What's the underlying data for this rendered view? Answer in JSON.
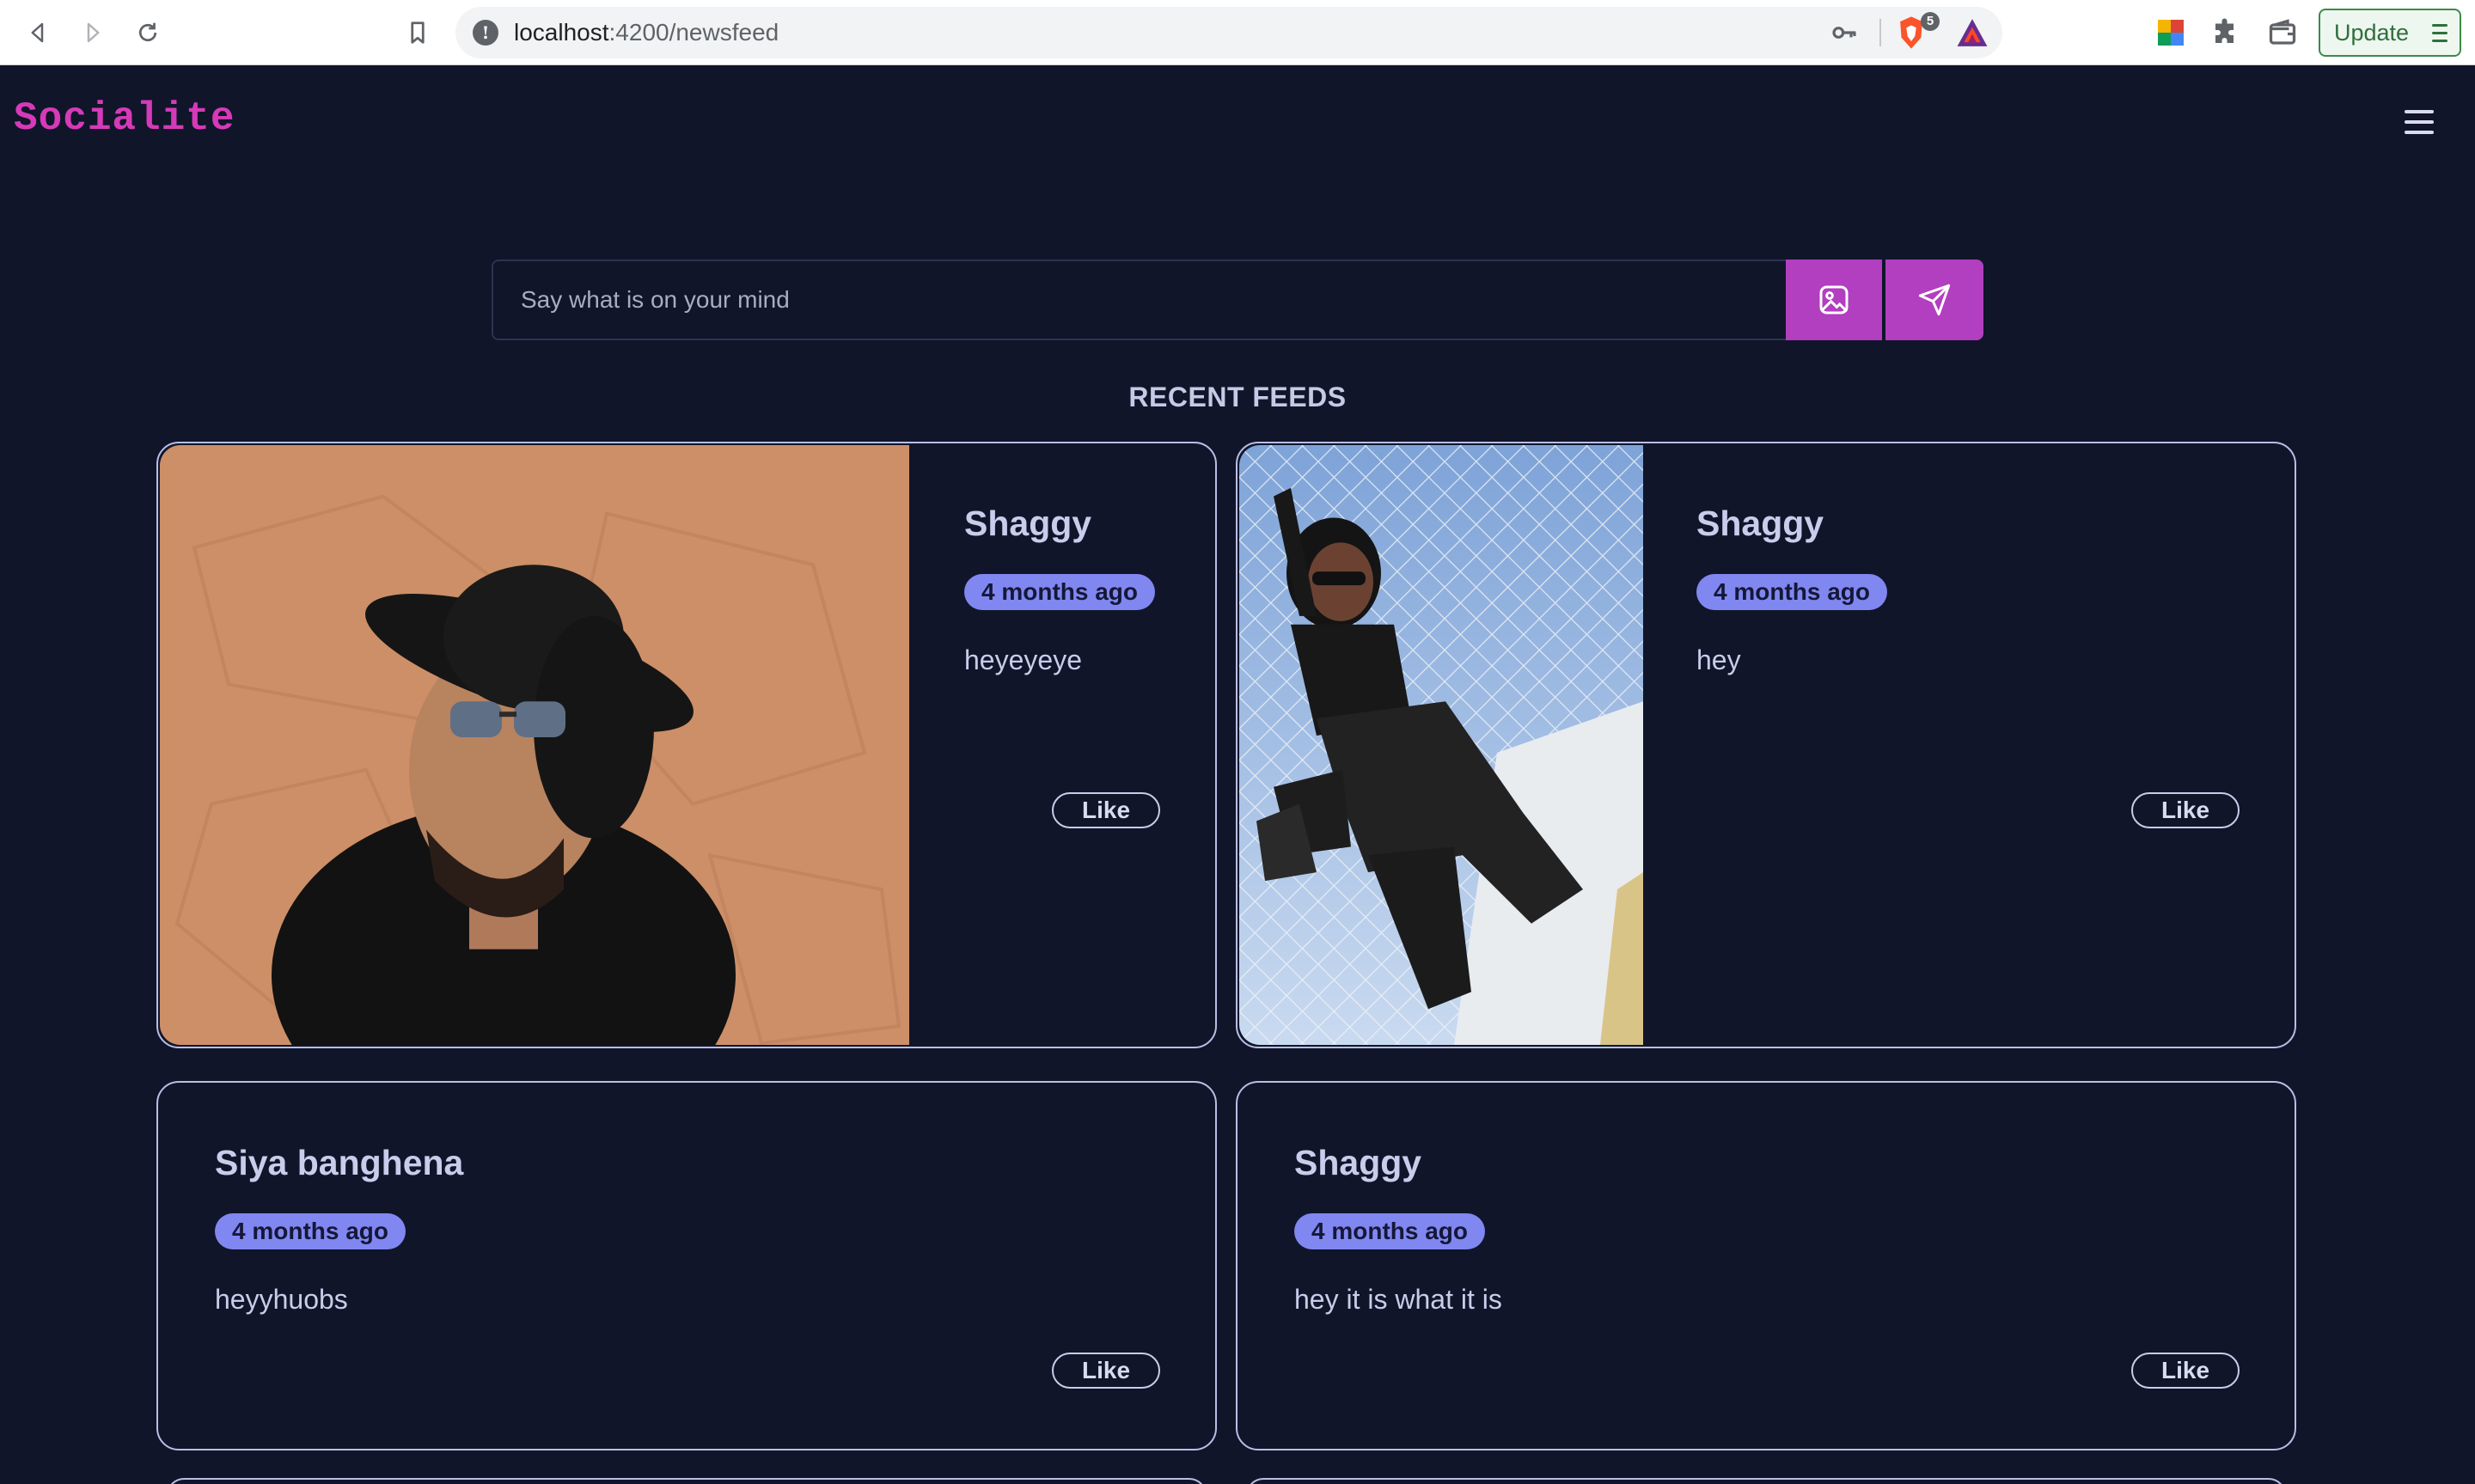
{
  "browser": {
    "url_host": "localhost",
    "url_path": ":4200/newsfeed",
    "brave_badge": "5",
    "update_label": "Update"
  },
  "app": {
    "logo": "Socialite"
  },
  "composer": {
    "placeholder": "Say what is on your mind"
  },
  "feed": {
    "title": "RECENT FEEDS",
    "posts": [
      {
        "author": "Shaggy",
        "time": "4 months ago",
        "text": "heyeyeye",
        "like_label": "Like",
        "photo": "man-in-hat-sunglasses"
      },
      {
        "author": "Shaggy",
        "time": "4 months ago",
        "text": "hey",
        "like_label": "Like",
        "photo": "woman-on-fence"
      },
      {
        "author": "Siya banghena",
        "time": "4 months ago",
        "text": "heyyhuobs",
        "like_label": "Like"
      },
      {
        "author": "Shaggy",
        "time": "4 months ago",
        "text": "hey it is what it is",
        "like_label": "Like"
      }
    ]
  },
  "colors": {
    "background": "#10152a",
    "accent": "#b23ec0",
    "logo": "#d63ab8",
    "badge": "#8187f0",
    "card_border": "#b7bfe4"
  }
}
